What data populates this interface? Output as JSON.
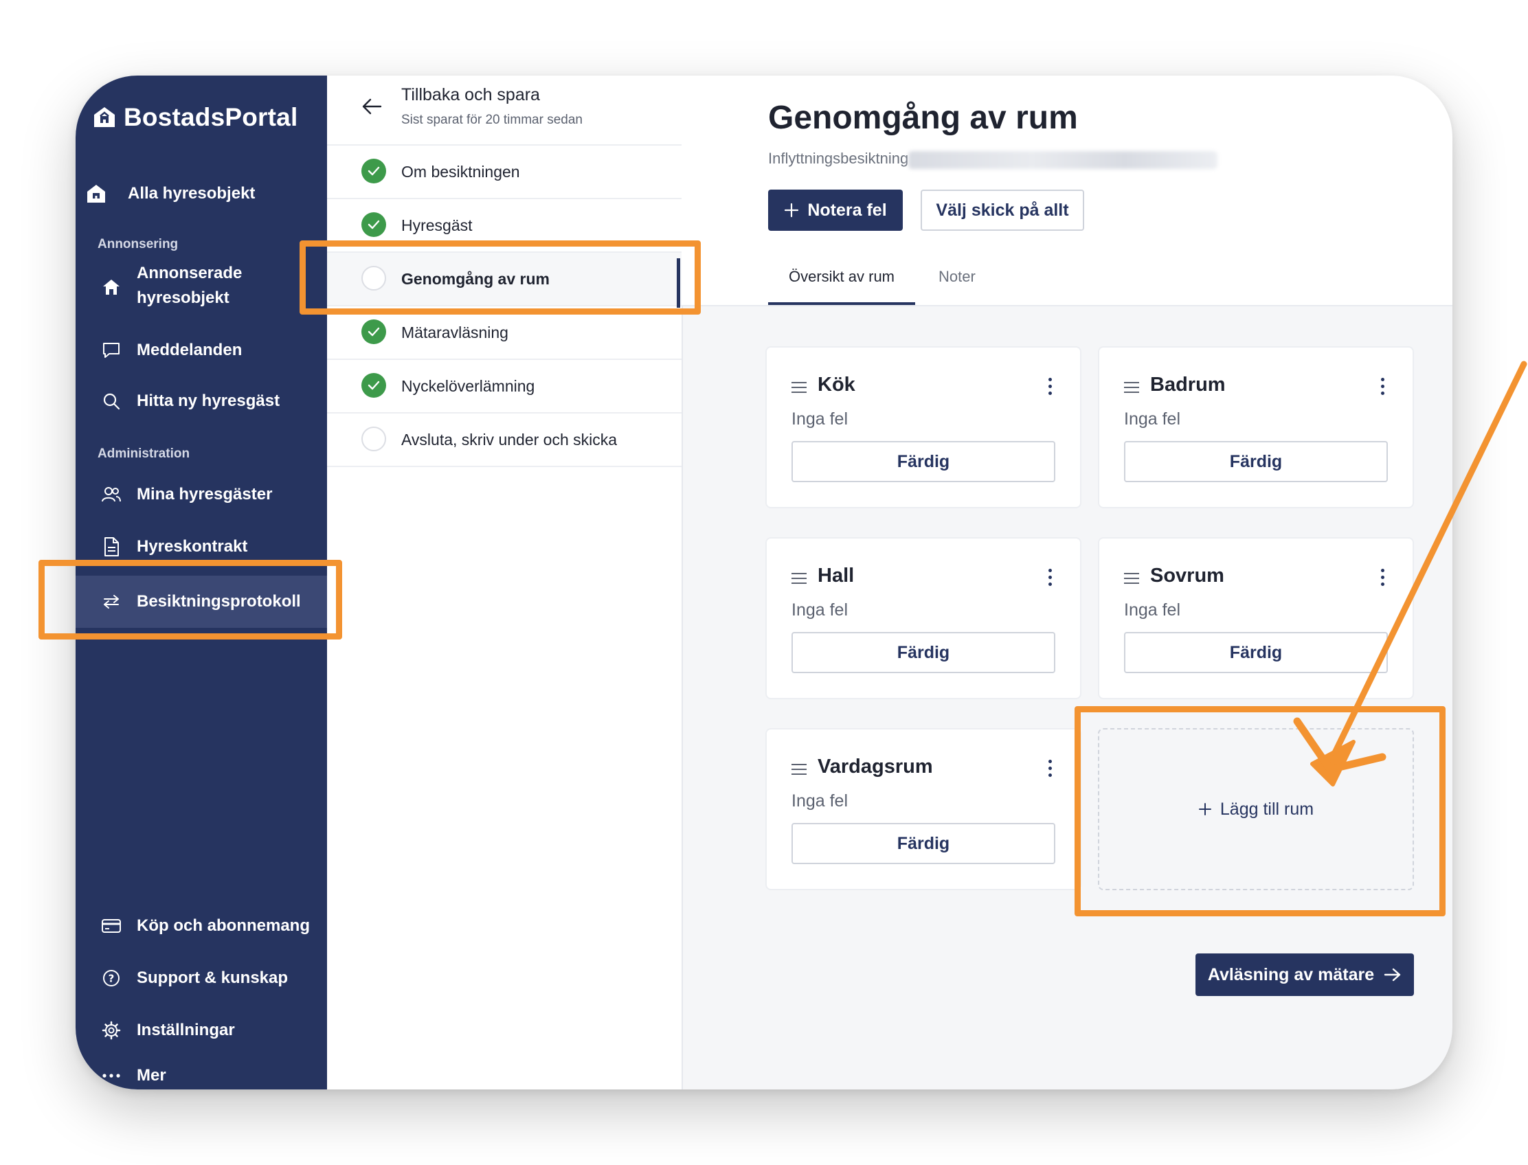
{
  "app": {
    "name": "BostadsPortal"
  },
  "sidebar": {
    "all_objects": "Alla hyresobjekt",
    "section_ads": "Annonsering",
    "ads_items": [
      {
        "label_line1": "Annonserade",
        "label_line2": "hyresobjekt",
        "icon": "house-icon"
      },
      {
        "label": "Meddelanden",
        "icon": "chat-icon"
      },
      {
        "label": "Hitta ny hyresgäst",
        "icon": "search-icon"
      }
    ],
    "section_admin": "Administration",
    "admin_items": [
      {
        "label": "Mina hyresgäster",
        "icon": "users-icon"
      },
      {
        "label": "Hyreskontrakt",
        "icon": "document-icon"
      },
      {
        "label": "Besiktningsprotokoll",
        "icon": "arrows-icon"
      }
    ],
    "bottom_items": [
      {
        "label": "Köp och abonnemang",
        "icon": "card-icon"
      },
      {
        "label": "Support & kunskap",
        "icon": "help-icon"
      },
      {
        "label": "Inställningar",
        "icon": "gear-icon"
      },
      {
        "label": "Mer",
        "icon": "more-icon"
      }
    ]
  },
  "steps_panel": {
    "back_title": "Tillbaka och spara",
    "back_subtitle": "Sist sparat för 20 timmar sedan",
    "steps": [
      {
        "label": "Om besiktningen",
        "done": true
      },
      {
        "label": "Hyresgäst",
        "done": true
      },
      {
        "label": "Genomgång av rum",
        "done": false,
        "active": true
      },
      {
        "label": "Mätaravläsning",
        "done": true
      },
      {
        "label": "Nyckelöverlämning",
        "done": true
      },
      {
        "label": "Avsluta, skriv under och skicka",
        "done": false
      }
    ]
  },
  "main": {
    "title": "Genomgång av rum",
    "subtitle": "Inflyttningsbesiktning -",
    "btn_note": "Notera fel",
    "btn_condition": "Välj skick på allt",
    "tabs": [
      "Översikt av rum",
      "Noter"
    ],
    "rooms": [
      {
        "name": "Kök",
        "status": "Inga fel",
        "button": "Färdig"
      },
      {
        "name": "Badrum",
        "status": "Inga fel",
        "button": "Färdig"
      },
      {
        "name": "Hall",
        "status": "Inga fel",
        "button": "Färdig"
      },
      {
        "name": "Sovrum",
        "status": "Inga fel",
        "button": "Färdig"
      },
      {
        "name": "Vardagsrum",
        "status": "Inga fel",
        "button": "Färdig"
      }
    ],
    "add_room": "Lägg till rum",
    "next_button": "Avläsning av mätare"
  },
  "colors": {
    "navy": "#263460",
    "highlight": "#f39331",
    "done_green": "#3d9a4a"
  }
}
